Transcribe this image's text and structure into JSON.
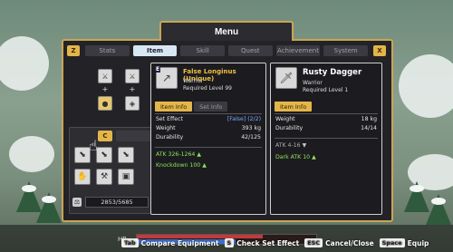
{
  "window": {
    "title": "Menu"
  },
  "tabbar": {
    "left_key": "Z",
    "right_key": "X",
    "tabs": [
      {
        "label": "Stats",
        "active": false
      },
      {
        "label": "Item",
        "active": true
      },
      {
        "label": "Skill",
        "active": false
      },
      {
        "label": "Quest",
        "active": false
      },
      {
        "label": "Achievement",
        "active": false
      },
      {
        "label": "System",
        "active": false
      }
    ]
  },
  "equipment": {
    "slots": [
      "sword-icon",
      "sword-icon",
      "ring-icon",
      "shield-icon"
    ],
    "inventory_tab_key": "C",
    "inventory_items": [
      "boot-icon",
      "boot-icon",
      "boot-icon",
      "glove-icon",
      "hammer-icon",
      "armor-icon"
    ],
    "weight": "2853/5685"
  },
  "selected_item": {
    "rank": "E",
    "name": "False Longinus (Unique)",
    "class": "Warrior",
    "required": "Required Level 99",
    "tabs": {
      "info": "Item Info",
      "set": "Set Info"
    },
    "stats": [
      {
        "label": "Set Effect",
        "value": "[False] (2/2)"
      },
      {
        "label": "Weight",
        "value": "393 kg"
      },
      {
        "label": "Durability",
        "value": "42/125"
      }
    ],
    "bonuses": [
      "ATK 326-1264",
      "Knockdown 100"
    ]
  },
  "compare_item": {
    "name": "Rusty Dagger",
    "class": "Warrior",
    "required": "Required Level 1",
    "tab": "Item Info",
    "stats": [
      {
        "label": "Weight",
        "value": "18 kg"
      },
      {
        "label": "Durability",
        "value": "14/14"
      }
    ],
    "base": "ATK 4-16",
    "bonus": "Dark ATK 10"
  },
  "hud": {
    "hp_label": "HP"
  },
  "hints": [
    {
      "key": "Tab",
      "label": "Compare Equipment"
    },
    {
      "key": "S",
      "label": "Check Set Effect"
    },
    {
      "key": "ESC",
      "label": "Cancel/Close"
    },
    {
      "key": "Space",
      "label": "Equip"
    }
  ]
}
